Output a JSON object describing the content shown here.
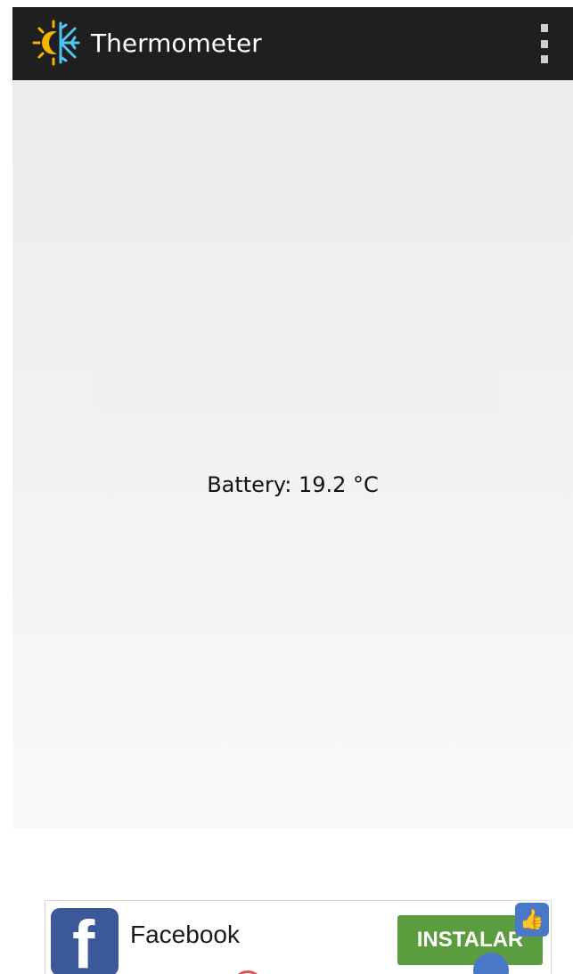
{
  "app_bar": {
    "title": "Thermometer",
    "icon": "sun-snowflake-icon",
    "overflow_icon": "more-vert-icon",
    "background": "#1f1f1f"
  },
  "main": {
    "battery_label": "Battery: 19.2 °C"
  },
  "ad_banner": {
    "app_name": "Facebook",
    "install_label": "INSTALAR",
    "logo_icon": "facebook-logo-icon",
    "install_color": "#5b9c3e"
  }
}
